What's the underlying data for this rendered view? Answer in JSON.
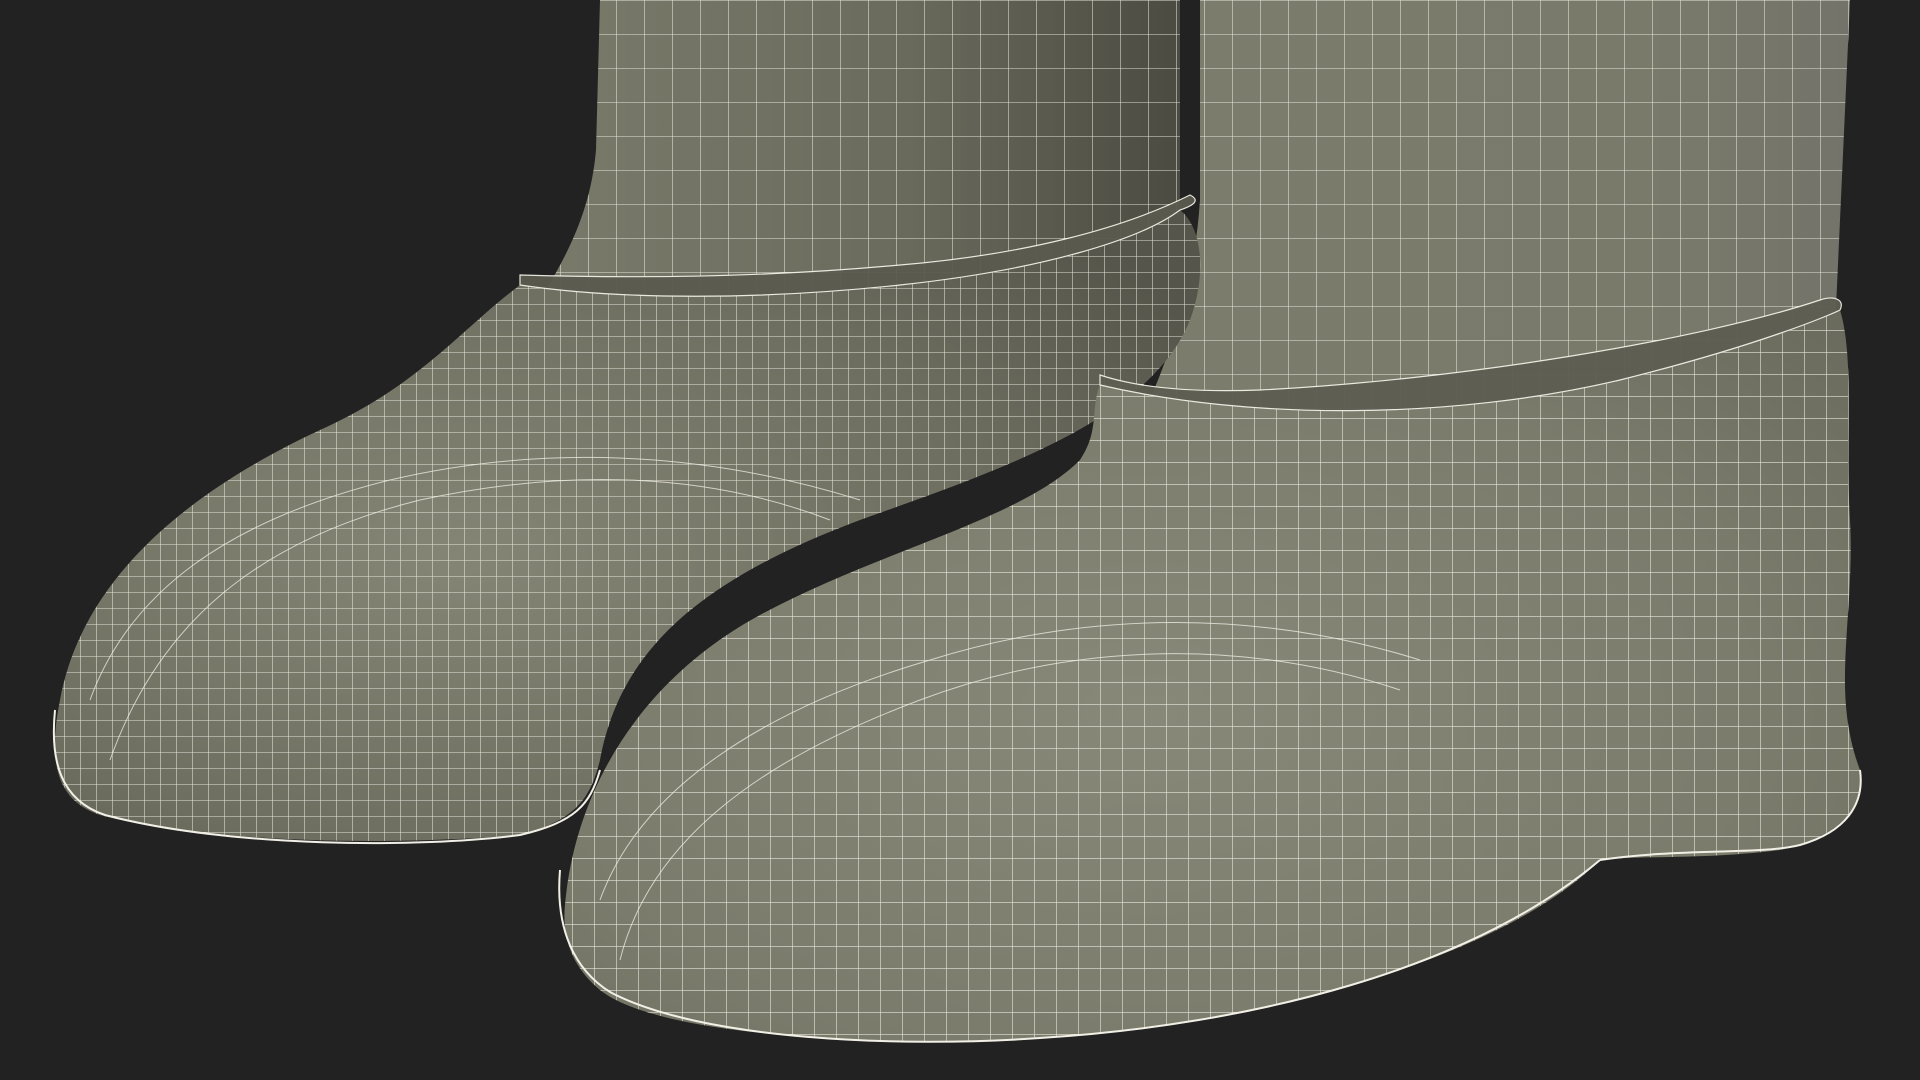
{
  "scene": {
    "background_color": "#222222",
    "mesh_color": "#7a7a6c",
    "wire_color": "#f2f0e6",
    "shadow_color": "#5f5f54",
    "highlight_color": "#8a8a7b",
    "subject": "wireframe-boots"
  }
}
